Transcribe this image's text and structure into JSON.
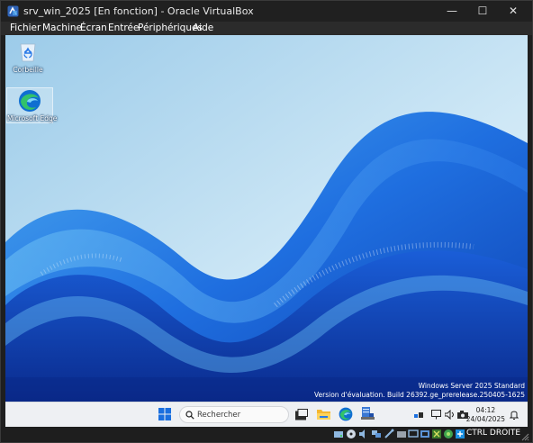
{
  "window": {
    "title": "srv_win_2025 [En fonction] - Oracle VirtualBox",
    "controls": [
      "—",
      "☐",
      "✕"
    ]
  },
  "menu": [
    "Fichier",
    "Machine",
    "Écran",
    "Entrée",
    "Périphériques",
    "Aide"
  ],
  "desktop": {
    "icons": [
      {
        "label": "Corbeille",
        "icon": "recycle-bin-icon"
      },
      {
        "label": "Microsoft Edge",
        "icon": "edge-icon"
      }
    ],
    "watermark": {
      "line1": "Windows Server 2025 Standard",
      "line2": "Version d'évaluation. Build 26392.ge_prerelease.250405-1625"
    }
  },
  "taskbar": {
    "search_placeholder": "Rechercher",
    "apps": [
      "start-icon",
      "search-icon",
      "task-view-icon",
      "file-explorer-icon",
      "edge-icon",
      "server-manager-icon"
    ],
    "tray": [
      "network-icon",
      "display-icon",
      "speaker-icon",
      "camera-icon"
    ],
    "time": "04:12",
    "date": "24/04/2025"
  },
  "statusbar": {
    "host_key": "CTRL DROITE",
    "icons": [
      "hard-disk-icon",
      "optical-drive-icon",
      "audio-icon",
      "network-adapter-icon",
      "usb-icon",
      "shared-folders-icon",
      "display-icon",
      "recording-icon",
      "capture-icon",
      "cpu-icon",
      "mouse-integration-icon",
      "keyboard-icon"
    ]
  },
  "colors": {
    "accent": "#1a6fdf",
    "wallpaper_sky": "#a9d3ec",
    "wallpaper_wave": "#1e63d6"
  }
}
